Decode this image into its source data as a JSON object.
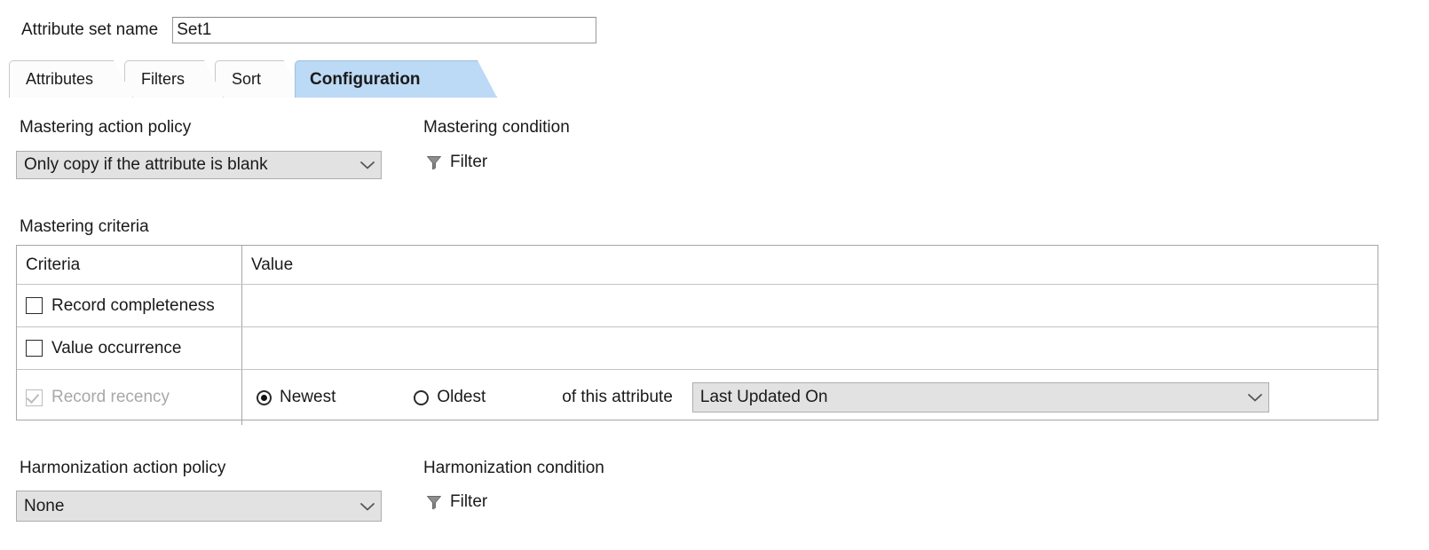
{
  "form": {
    "name_label": "Attribute set name",
    "name_value": "Set1",
    "name_placeholder": "Attribute set name"
  },
  "tabs": [
    {
      "label": "Attributes",
      "active": false
    },
    {
      "label": "Filters",
      "active": false
    },
    {
      "label": "Sort",
      "active": false
    },
    {
      "label": "Configuration",
      "active": true
    }
  ],
  "mastering": {
    "policy_label": "Mastering action policy",
    "policy_value": "Only copy if the attribute is blank",
    "condition_label": "Mastering condition",
    "filter_label": "Filter",
    "criteria_label": "Mastering criteria"
  },
  "criteria_table": {
    "headers": [
      "Criteria",
      "Value"
    ],
    "rows": [
      {
        "label": "Record completeness",
        "checked": false,
        "disabled": false,
        "value": ""
      },
      {
        "label": "Value occurrence",
        "checked": false,
        "disabled": false,
        "value": ""
      },
      {
        "label": "Record recency",
        "checked": true,
        "disabled": true,
        "radios": [
          {
            "label": "Newest",
            "selected": true
          },
          {
            "label": "Oldest",
            "selected": false
          }
        ],
        "middle_text": "of this attribute",
        "attribute_value": "Last Updated On"
      }
    ]
  },
  "harmonization": {
    "policy_label": "Harmonization action policy",
    "policy_value": "None",
    "condition_label": "Harmonization condition",
    "filter_label": "Filter"
  },
  "colors": {
    "active_tab": "#bcd9f5",
    "combo_bg": "#e2e2e2",
    "border": "#a6a6a6",
    "text": "#1a1a1a",
    "disabled_text": "#a8a8a8"
  },
  "icons": {
    "filter": "funnel-icon",
    "dropdown": "chevron-down-icon",
    "checkbox": "checkbox-icon",
    "radio": "radio-icon"
  }
}
